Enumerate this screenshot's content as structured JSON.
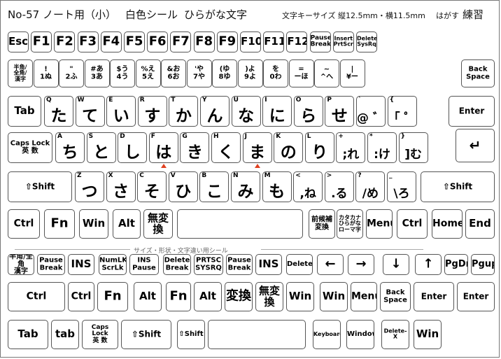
{
  "header": {
    "product": "No-57 ノート用（小）",
    "color": "白色シール",
    "style": "ひらがな文字",
    "size": "文字キーサイズ 縦12.5mm・横11.5mm",
    "peel": "はがす",
    "practice": "練習"
  },
  "divider_label": "サイズ・形状・文字違い用シール",
  "rows": {
    "function": [
      "Esc",
      "F1",
      "F2",
      "F3",
      "F4",
      "F5",
      "F6",
      "F7",
      "F8",
      "F9",
      "F10",
      "F11",
      "F12",
      "Pause\nBreak",
      "Insert\nPrtScr",
      "Delete\nSysRq"
    ],
    "number": [
      "半角/\n全角/\n漢字",
      "!\n1ぬ",
      "\"\n2ふ",
      "#あ\n3あ",
      "$う\n4う",
      "%え\n5え",
      "&お\n6お",
      "'や\n7や",
      "(ゆ\n8ゆ",
      ")よ\n9よ",
      "を\n0わ",
      "=\nーほ",
      "~\n^へ",
      "|\n¥ー",
      "Back\nSpace"
    ],
    "top": {
      "left": "Tab",
      "keys": [
        {
          "l": "Q",
          "k": "た"
        },
        {
          "l": "W",
          "k": "て"
        },
        {
          "l": "E",
          "k": "い"
        },
        {
          "l": "R",
          "k": "す"
        },
        {
          "l": "T",
          "k": "か"
        },
        {
          "l": "Y",
          "k": "ん"
        },
        {
          "l": "U",
          "k": "な"
        },
        {
          "l": "I",
          "k": "に"
        },
        {
          "l": "O",
          "k": "ら"
        },
        {
          "l": "P",
          "k": "せ"
        },
        {
          "l": "`",
          "k": "@ ゛"
        },
        {
          "l": "{",
          "k": "「 ゜"
        }
      ],
      "enter": "Enter"
    },
    "home": {
      "left": "Caps Lock\n英 数",
      "keys": [
        {
          "l": "A",
          "k": "ち"
        },
        {
          "l": "S",
          "k": "と"
        },
        {
          "l": "D",
          "k": "し"
        },
        {
          "l": "F",
          "k": "は"
        },
        {
          "l": "G",
          "k": "き"
        },
        {
          "l": "H",
          "k": "く"
        },
        {
          "l": "J",
          "k": "ま"
        },
        {
          "l": "K",
          "k": "の"
        },
        {
          "l": "L",
          "k": "り"
        },
        {
          "l": "+",
          "k": ";れ"
        },
        {
          "l": "*",
          "k": ":け"
        },
        {
          "l": "}",
          "k": "]む"
        }
      ]
    },
    "shift": {
      "left": "⇧Shift",
      "keys": [
        {
          "l": "Z",
          "k": "つ"
        },
        {
          "l": "X",
          "k": "さ"
        },
        {
          "l": "C",
          "k": "そ"
        },
        {
          "l": "V",
          "k": "ひ"
        },
        {
          "l": "B",
          "k": "こ"
        },
        {
          "l": "N",
          "k": "み"
        },
        {
          "l": "M",
          "k": "も"
        },
        {
          "l": "<",
          "k": ",ね"
        },
        {
          "l": ">",
          "k": ".る"
        },
        {
          "l": "?",
          "k": "/め"
        },
        {
          "l": "_",
          "k": "\\ろ"
        }
      ],
      "right": "⇧Shift"
    },
    "bottom": [
      "Ctrl",
      "Fn",
      "Win",
      "Alt",
      "無変換",
      "",
      "前候補\n変換",
      "カタカナ\nひらがな\nローマ字",
      "Menu",
      "Ctrl",
      "Home",
      "End"
    ],
    "extra1": [
      "半角/全角\n漢字",
      "Pause\nBreak",
      "INS",
      "NumLK\nScrLk",
      "INS\nPause",
      "Delete\nBreak",
      "PRTSC\nSYSRQ",
      "Pause\nBreak",
      "INS",
      "Delete",
      "←",
      "→",
      "↓",
      "↑",
      "PgDn",
      "Pgup"
    ],
    "extra2": [
      "Ctrl",
      "Ctrl",
      "Fn",
      "Alt",
      "Fn",
      "Alt",
      "変換",
      "無変換",
      "Win",
      "Win",
      "Menu",
      "Back\nSpace",
      "Enter",
      "Enter"
    ],
    "extra3": [
      "Tab",
      "tab",
      "Caps Lock\n英 数",
      "⇧Shift",
      "⇧Shift",
      "",
      "Keyboard",
      "Window",
      "Delete-X",
      "Win"
    ]
  }
}
